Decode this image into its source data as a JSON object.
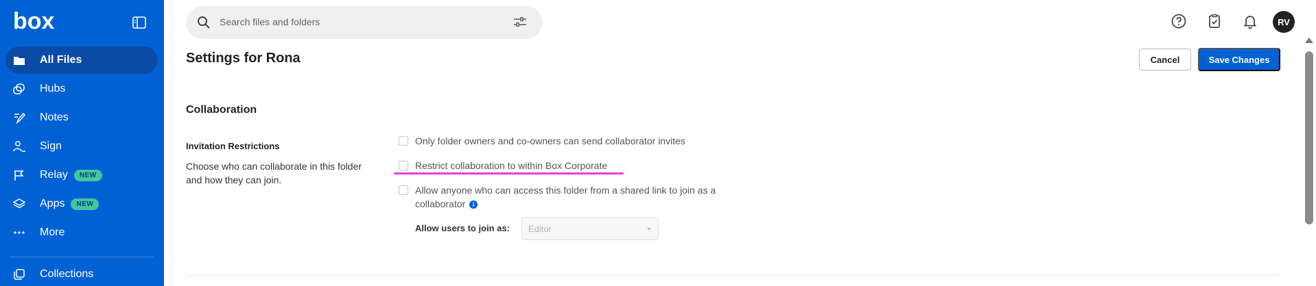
{
  "brand": {
    "logo_text": "box",
    "sidebar_color": "#0061d5",
    "active_color": "#0a4ba6"
  },
  "sidebar": {
    "items": [
      {
        "label": "All Files",
        "icon": "folder-icon",
        "active": true
      },
      {
        "label": "Hubs",
        "icon": "hubs-icon"
      },
      {
        "label": "Notes",
        "icon": "notes-icon"
      },
      {
        "label": "Sign",
        "icon": "sign-icon"
      },
      {
        "label": "Relay",
        "icon": "relay-flag-icon",
        "badge": "NEW"
      },
      {
        "label": "Apps",
        "icon": "apps-icon",
        "badge": "NEW"
      },
      {
        "label": "More",
        "icon": "more-dots-icon"
      },
      {
        "label": "Collections",
        "icon": "collections-icon"
      }
    ]
  },
  "header": {
    "search_placeholder": "Search files and folders",
    "avatar_initials": "RV"
  },
  "page": {
    "title": "Settings for Rona",
    "cancel_label": "Cancel",
    "save_label": "Save Changes",
    "section_title": "Collaboration",
    "subsection_title": "Invitation Restrictions",
    "description": "Choose who can collaborate in this folder and how they can join.",
    "options": [
      {
        "label": "Only folder owners and co-owners can send collaborator invites",
        "checked": false
      },
      {
        "label": "Restrict collaboration to within Box Corporate",
        "checked": false,
        "highlighted": true
      },
      {
        "label": "Allow anyone who can access this folder from a shared link to join as a collaborator",
        "checked": false,
        "info_icon": true
      }
    ],
    "join_as_label": "Allow users to join as:",
    "join_as_value": "Editor"
  }
}
